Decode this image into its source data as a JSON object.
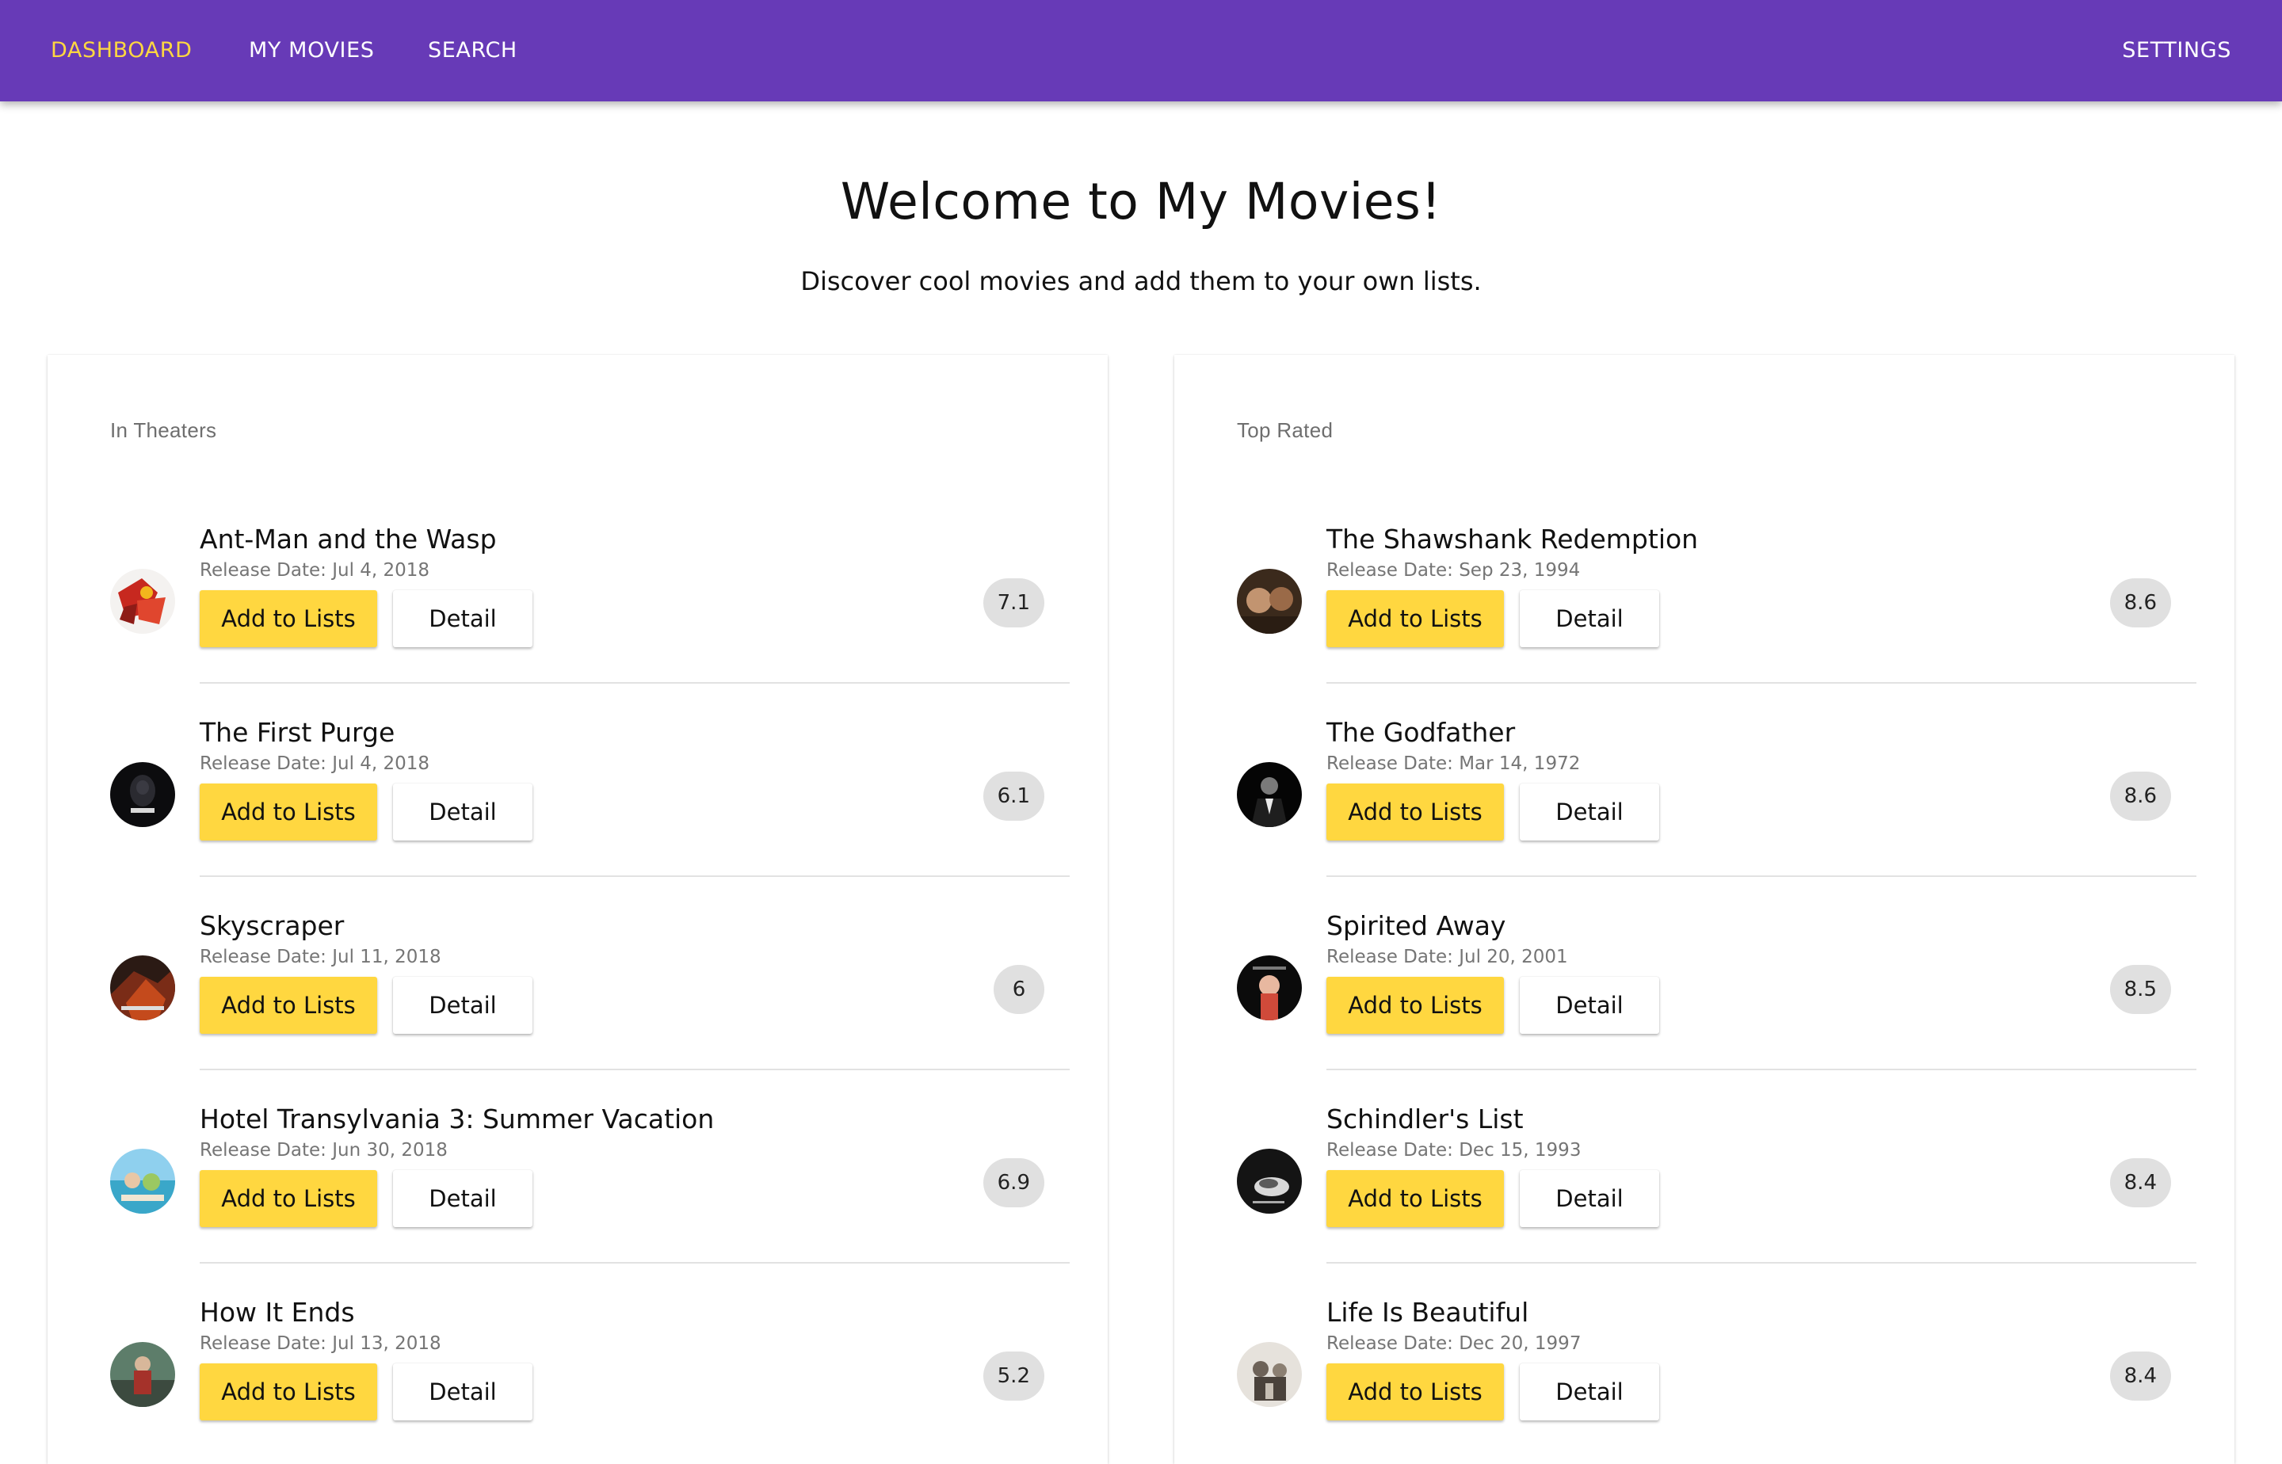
{
  "nav": {
    "dashboard": "DASHBOARD",
    "my_movies": "MY MOVIES",
    "search": "SEARCH",
    "settings": "SETTINGS"
  },
  "header": {
    "title": "Welcome to My Movies!",
    "subtitle": "Discover cool movies and add them to your own lists."
  },
  "colors": {
    "topbar": "#673ab7",
    "accent": "#ffd740",
    "score_chip": "#e0e0e0"
  },
  "in_theaters": {
    "heading": "In Theaters",
    "movies": [
      {
        "title": "Ant-Man and the Wasp",
        "release": "Release Date: Jul 4, 2018",
        "score": "7.1",
        "add_label": "Add to Lists",
        "detail_label": "Detail"
      },
      {
        "title": "The First Purge",
        "release": "Release Date: Jul 4, 2018",
        "score": "6.1",
        "add_label": "Add to Lists",
        "detail_label": "Detail"
      },
      {
        "title": "Skyscraper",
        "release": "Release Date: Jul 11, 2018",
        "score": "6",
        "add_label": "Add to Lists",
        "detail_label": "Detail"
      },
      {
        "title": "Hotel Transylvania 3: Summer Vacation",
        "release": "Release Date: Jun 30, 2018",
        "score": "6.9",
        "add_label": "Add to Lists",
        "detail_label": "Detail"
      },
      {
        "title": "How It Ends",
        "release": "Release Date: Jul 13, 2018",
        "score": "5.2",
        "add_label": "Add to Lists",
        "detail_label": "Detail"
      }
    ]
  },
  "top_rated": {
    "heading": "Top Rated",
    "movies": [
      {
        "title": "The Shawshank Redemption",
        "release": "Release Date: Sep 23, 1994",
        "score": "8.6",
        "add_label": "Add to Lists",
        "detail_label": "Detail"
      },
      {
        "title": "The Godfather",
        "release": "Release Date: Mar 14, 1972",
        "score": "8.6",
        "add_label": "Add to Lists",
        "detail_label": "Detail"
      },
      {
        "title": "Spirited Away",
        "release": "Release Date: Jul 20, 2001",
        "score": "8.5",
        "add_label": "Add to Lists",
        "detail_label": "Detail"
      },
      {
        "title": "Schindler's List",
        "release": "Release Date: Dec 15, 1993",
        "score": "8.4",
        "add_label": "Add to Lists",
        "detail_label": "Detail"
      },
      {
        "title": "Life Is Beautiful",
        "release": "Release Date: Dec 20, 1997",
        "score": "8.4",
        "add_label": "Add to Lists",
        "detail_label": "Detail"
      }
    ]
  }
}
